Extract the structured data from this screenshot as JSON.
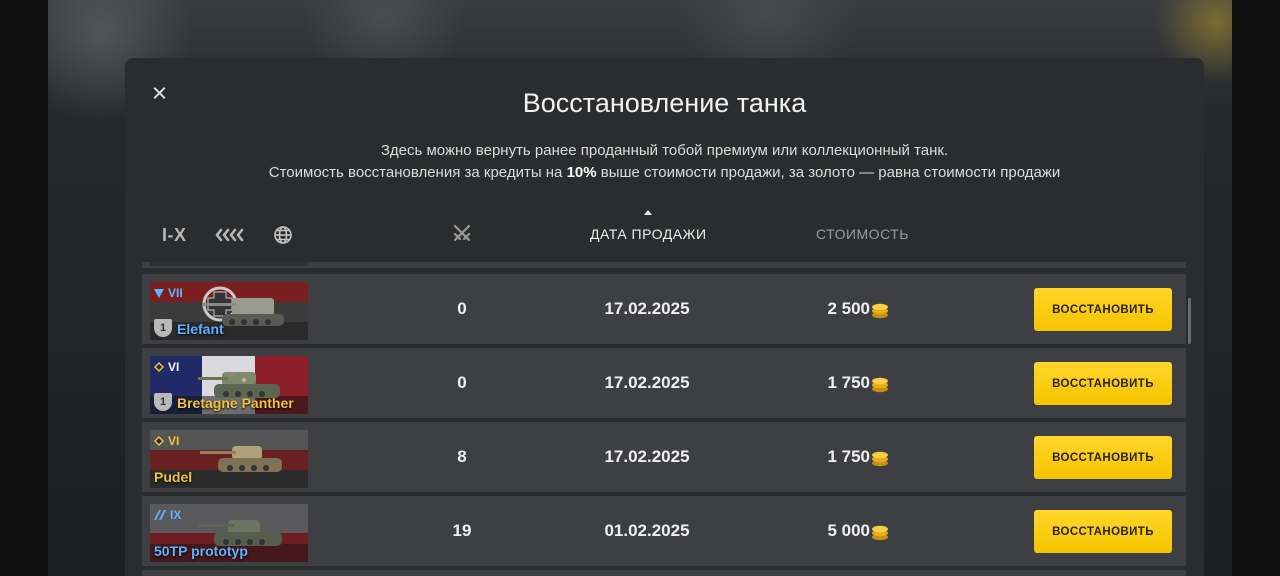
{
  "modal": {
    "title": "Восстановление танка",
    "desc_line1": "Здесь можно вернуть ранее проданный тобой премиум или коллекционный танк.",
    "desc_line2_pre": "Стоимость восстановления за кредиты на ",
    "desc_line2_bold": "10%",
    "desc_line2_post": " выше стоимости продажи, за золото — равна стоимости продажи"
  },
  "filters": {
    "tier_label": "I-X",
    "nation_icon": "nation-filter-icon",
    "globe_icon": "globe-icon"
  },
  "columns": {
    "battles_icon": "crossed-swords-icon",
    "date": "ДАТА ПРОДАЖИ",
    "cost": "СТОИМОСТЬ",
    "sort": "ascending"
  },
  "rows": [
    {
      "tier": "VII",
      "name": "Elefant",
      "name_color": "#5fb3ff",
      "class_icon": "td-icon",
      "mastery": "1",
      "nation": "germany",
      "battles": "0",
      "date": "17.02.2025",
      "cost": "2 500",
      "button": "ВОССТАНОВИТЬ"
    },
    {
      "tier": "VI",
      "name": "Bretagne Panther",
      "name_color": "#f3c33b",
      "class_icon": "medium-tank-icon",
      "mastery": "1",
      "nation": "france",
      "battles": "0",
      "date": "17.02.2025",
      "cost": "1 750",
      "button": "ВОССТАНОВИТЬ"
    },
    {
      "tier": "VI",
      "name": "Pudel",
      "name_color": "#f3c33b",
      "class_icon": "medium-tank-icon",
      "mastery": "",
      "nation": "germany",
      "battles": "8",
      "date": "17.02.2025",
      "cost": "1 750",
      "button": "ВОССТАНОВИТЬ"
    },
    {
      "tier": "IX",
      "name": "50TP prototyp",
      "name_color": "#5fb3ff",
      "class_icon": "heavy-tank-icon",
      "mastery": "",
      "nation": "poland",
      "battles": "19",
      "date": "01.02.2025",
      "cost": "5 000",
      "button": "ВОССТАНОВИТЬ"
    }
  ],
  "colors": {
    "accent_gold": "#ffd62a",
    "premium_name": "#f3c33b",
    "collector_name": "#5fb3ff"
  }
}
